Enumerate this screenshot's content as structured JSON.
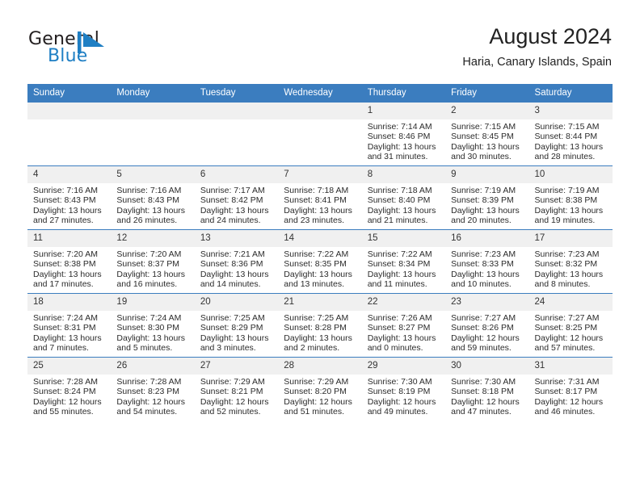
{
  "brand": {
    "name_part1": "General",
    "name_part2": "Blue",
    "mark_icon": "blue-flag-triangle-icon",
    "mark_color": "#1f7fc4"
  },
  "header": {
    "title": "August 2024",
    "location": "Haria, Canary Islands, Spain"
  },
  "theme": {
    "header_bar_color": "#3b7dbf",
    "daynum_band_color": "#f0f0f0",
    "text_color": "#2b2b2b",
    "page_background": "#ffffff"
  },
  "calendar": {
    "weekday_headers": [
      "Sunday",
      "Monday",
      "Tuesday",
      "Wednesday",
      "Thursday",
      "Friday",
      "Saturday"
    ],
    "weeks": [
      [
        {
          "day": "",
          "info": ""
        },
        {
          "day": "",
          "info": ""
        },
        {
          "day": "",
          "info": ""
        },
        {
          "day": "",
          "info": ""
        },
        {
          "day": "1",
          "info": "Sunrise: 7:14 AM\nSunset: 8:46 PM\nDaylight: 13 hours\nand 31 minutes."
        },
        {
          "day": "2",
          "info": "Sunrise: 7:15 AM\nSunset: 8:45 PM\nDaylight: 13 hours\nand 30 minutes."
        },
        {
          "day": "3",
          "info": "Sunrise: 7:15 AM\nSunset: 8:44 PM\nDaylight: 13 hours\nand 28 minutes."
        }
      ],
      [
        {
          "day": "4",
          "info": "Sunrise: 7:16 AM\nSunset: 8:43 PM\nDaylight: 13 hours\nand 27 minutes."
        },
        {
          "day": "5",
          "info": "Sunrise: 7:16 AM\nSunset: 8:43 PM\nDaylight: 13 hours\nand 26 minutes."
        },
        {
          "day": "6",
          "info": "Sunrise: 7:17 AM\nSunset: 8:42 PM\nDaylight: 13 hours\nand 24 minutes."
        },
        {
          "day": "7",
          "info": "Sunrise: 7:18 AM\nSunset: 8:41 PM\nDaylight: 13 hours\nand 23 minutes."
        },
        {
          "day": "8",
          "info": "Sunrise: 7:18 AM\nSunset: 8:40 PM\nDaylight: 13 hours\nand 21 minutes."
        },
        {
          "day": "9",
          "info": "Sunrise: 7:19 AM\nSunset: 8:39 PM\nDaylight: 13 hours\nand 20 minutes."
        },
        {
          "day": "10",
          "info": "Sunrise: 7:19 AM\nSunset: 8:38 PM\nDaylight: 13 hours\nand 19 minutes."
        }
      ],
      [
        {
          "day": "11",
          "info": "Sunrise: 7:20 AM\nSunset: 8:38 PM\nDaylight: 13 hours\nand 17 minutes."
        },
        {
          "day": "12",
          "info": "Sunrise: 7:20 AM\nSunset: 8:37 PM\nDaylight: 13 hours\nand 16 minutes."
        },
        {
          "day": "13",
          "info": "Sunrise: 7:21 AM\nSunset: 8:36 PM\nDaylight: 13 hours\nand 14 minutes."
        },
        {
          "day": "14",
          "info": "Sunrise: 7:22 AM\nSunset: 8:35 PM\nDaylight: 13 hours\nand 13 minutes."
        },
        {
          "day": "15",
          "info": "Sunrise: 7:22 AM\nSunset: 8:34 PM\nDaylight: 13 hours\nand 11 minutes."
        },
        {
          "day": "16",
          "info": "Sunrise: 7:23 AM\nSunset: 8:33 PM\nDaylight: 13 hours\nand 10 minutes."
        },
        {
          "day": "17",
          "info": "Sunrise: 7:23 AM\nSunset: 8:32 PM\nDaylight: 13 hours\nand 8 minutes."
        }
      ],
      [
        {
          "day": "18",
          "info": "Sunrise: 7:24 AM\nSunset: 8:31 PM\nDaylight: 13 hours\nand 7 minutes."
        },
        {
          "day": "19",
          "info": "Sunrise: 7:24 AM\nSunset: 8:30 PM\nDaylight: 13 hours\nand 5 minutes."
        },
        {
          "day": "20",
          "info": "Sunrise: 7:25 AM\nSunset: 8:29 PM\nDaylight: 13 hours\nand 3 minutes."
        },
        {
          "day": "21",
          "info": "Sunrise: 7:25 AM\nSunset: 8:28 PM\nDaylight: 13 hours\nand 2 minutes."
        },
        {
          "day": "22",
          "info": "Sunrise: 7:26 AM\nSunset: 8:27 PM\nDaylight: 13 hours\nand 0 minutes."
        },
        {
          "day": "23",
          "info": "Sunrise: 7:27 AM\nSunset: 8:26 PM\nDaylight: 12 hours\nand 59 minutes."
        },
        {
          "day": "24",
          "info": "Sunrise: 7:27 AM\nSunset: 8:25 PM\nDaylight: 12 hours\nand 57 minutes."
        }
      ],
      [
        {
          "day": "25",
          "info": "Sunrise: 7:28 AM\nSunset: 8:24 PM\nDaylight: 12 hours\nand 55 minutes."
        },
        {
          "day": "26",
          "info": "Sunrise: 7:28 AM\nSunset: 8:23 PM\nDaylight: 12 hours\nand 54 minutes."
        },
        {
          "day": "27",
          "info": "Sunrise: 7:29 AM\nSunset: 8:21 PM\nDaylight: 12 hours\nand 52 minutes."
        },
        {
          "day": "28",
          "info": "Sunrise: 7:29 AM\nSunset: 8:20 PM\nDaylight: 12 hours\nand 51 minutes."
        },
        {
          "day": "29",
          "info": "Sunrise: 7:30 AM\nSunset: 8:19 PM\nDaylight: 12 hours\nand 49 minutes."
        },
        {
          "day": "30",
          "info": "Sunrise: 7:30 AM\nSunset: 8:18 PM\nDaylight: 12 hours\nand 47 minutes."
        },
        {
          "day": "31",
          "info": "Sunrise: 7:31 AM\nSunset: 8:17 PM\nDaylight: 12 hours\nand 46 minutes."
        }
      ]
    ]
  }
}
